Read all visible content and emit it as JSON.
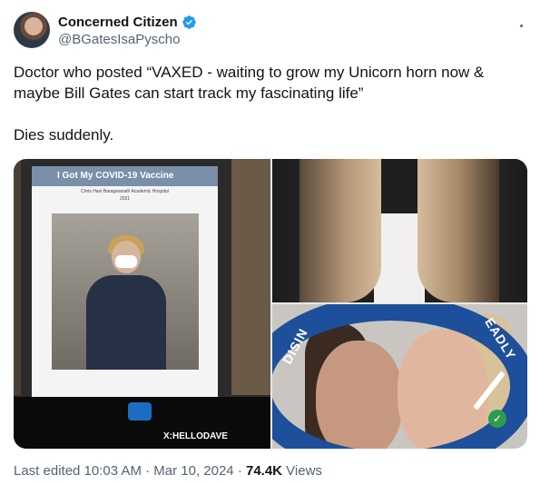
{
  "author": {
    "display_name": "Concerned Citizen",
    "handle": "@BGatesIsaPyscho",
    "verified_icon": "verified-badge-icon",
    "verified_color": "#1d9bf0"
  },
  "tweet": {
    "line1": "Doctor who posted “VAXED - waiting to grow my Unicorn horn now &",
    "line2": "maybe Bill Gates can start track my fascinating life”",
    "line3": "Dies suddenly."
  },
  "media": {
    "left_image": {
      "header": "I Got My COVID-19 Vaccine",
      "subheader": "Chris Hani Baragwanath Academic Hospital",
      "year": "2021",
      "watermark": "X:HELLODAVE"
    },
    "bottom_right_image": {
      "left_text": "DISIN",
      "right_text": "EADLY"
    }
  },
  "footer": {
    "edited": "Last edited 10:03 AM · Mar 10, 2024 · ",
    "views_count": "74.4K",
    "views_label": " Views"
  }
}
